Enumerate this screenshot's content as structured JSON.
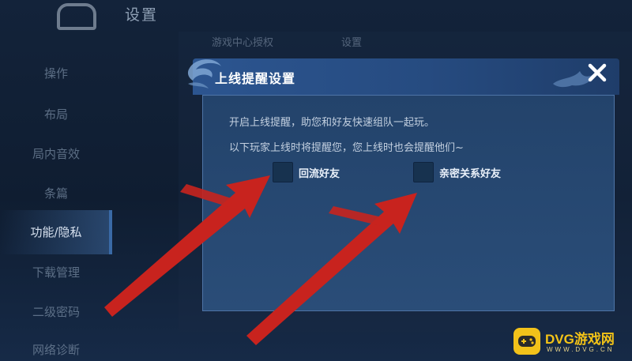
{
  "background": {
    "title": "设置",
    "top_row_left": "游戏中心授权",
    "top_row_right": "设置",
    "sidebar": {
      "items": [
        {
          "label": "操作"
        },
        {
          "label": "布局"
        },
        {
          "label": "局内音效"
        },
        {
          "label": "条篇"
        },
        {
          "label": "功能/隐私"
        },
        {
          "label": "下载管理"
        },
        {
          "label": "二级密码"
        },
        {
          "label": "网络诊断"
        }
      ],
      "active_index": 4
    }
  },
  "modal": {
    "title": "上线提醒设置",
    "description_1": "开启上线提醒，助您和好友快速组队一起玩。",
    "description_2": "以下玩家上线时将提醒您，您上线时也会提醒他们~",
    "options": [
      {
        "label": "回流好友",
        "checked": false
      },
      {
        "label": "亲密关系好友",
        "checked": false
      }
    ],
    "close_icon": "close-icon"
  },
  "annotations": {
    "arrow_color": "#c8231e",
    "arrows": 2
  },
  "watermark": {
    "text": "DVG游戏网",
    "subtext": "WWW.DVG.CN",
    "color": "#f3c317"
  }
}
